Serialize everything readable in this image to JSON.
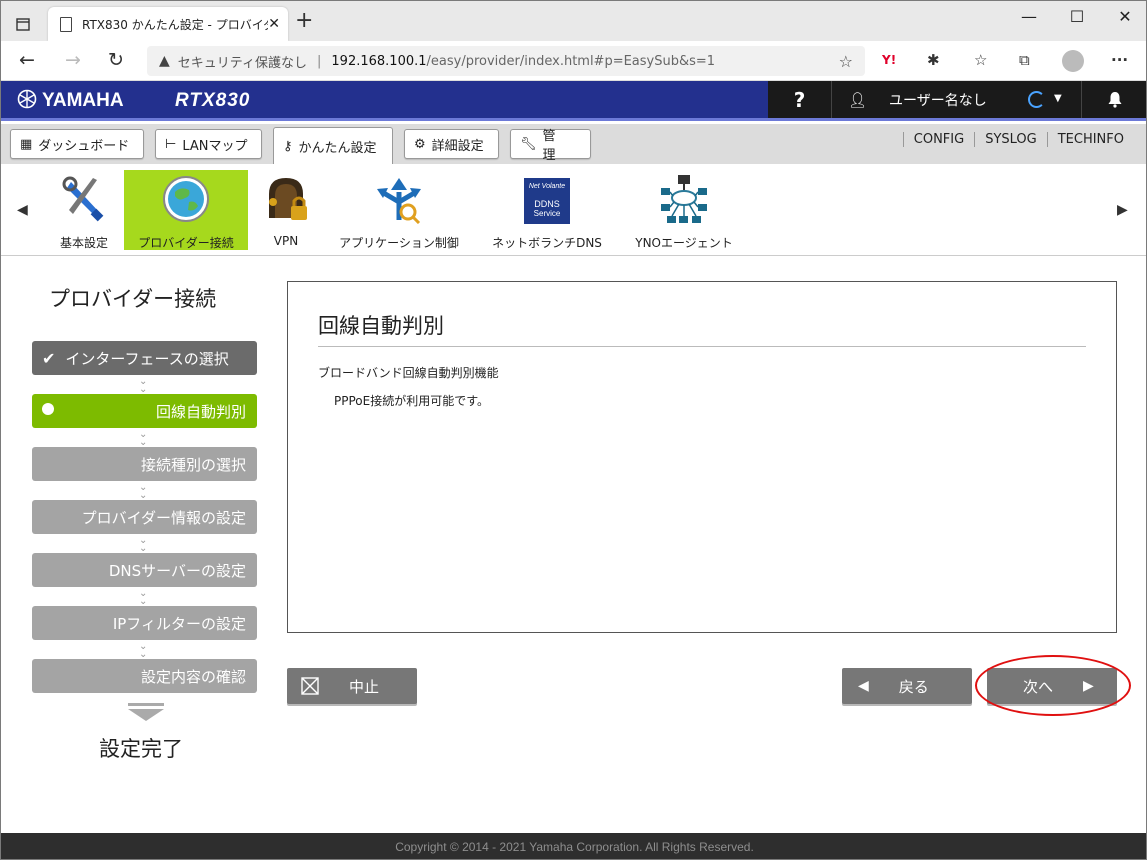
{
  "browser": {
    "tab_title": "RTX830 かんたん設定 - プロバイダー接",
    "security_label": "セキュリティ保護なし",
    "url_host": "192.168.100.1",
    "url_path": "/easy/provider/index.html#p=EasySub&s=1",
    "minimize": "—",
    "maximize": "☐",
    "close": "✕"
  },
  "header": {
    "brand": "YAMAHA",
    "model": "RTX830",
    "help": "?",
    "user_name": "ユーザー名なし"
  },
  "menu": {
    "dashboard": "ダッシュボード",
    "lanmap": "LANマップ",
    "easy": "かんたん設定",
    "detail": "詳細設定",
    "manage": "管　理",
    "config": "CONFIG",
    "syslog": "SYSLOG",
    "techinfo": "TECHINFO"
  },
  "icons": {
    "basic": "基本設定",
    "provider": "プロバイダー接続",
    "vpn": "VPN",
    "app": "アプリケーション制御",
    "netvolante": "ネットボランチDNS",
    "yno": "YNOエージェント",
    "ddns_logo_1": "Net Volante",
    "ddns_logo_2": "DDNS",
    "ddns_logo_3": "Service"
  },
  "sidebar": {
    "title": "プロバイダー接続",
    "steps": [
      "インターフェースの選択",
      "回線自動判別",
      "接続種別の選択",
      "プロバイダー情報の設定",
      "DNSサーバーの設定",
      "IPフィルターの設定",
      "設定内容の確認"
    ],
    "finish": "設定完了"
  },
  "content": {
    "title": "回線自動判別",
    "line1": "ブロードバンド回線自動判別機能",
    "line2": "PPPoE接続が利用可能です。"
  },
  "buttons": {
    "cancel": "中止",
    "back": "戻る",
    "next": "次へ"
  },
  "footer": "Copyright © 2014 - 2021 Yamaha Corporation. All Rights Reserved.",
  "colors": {
    "header_blue": "#23308e",
    "active_green": "#7dbb00",
    "highlight_red": "#e01010"
  }
}
